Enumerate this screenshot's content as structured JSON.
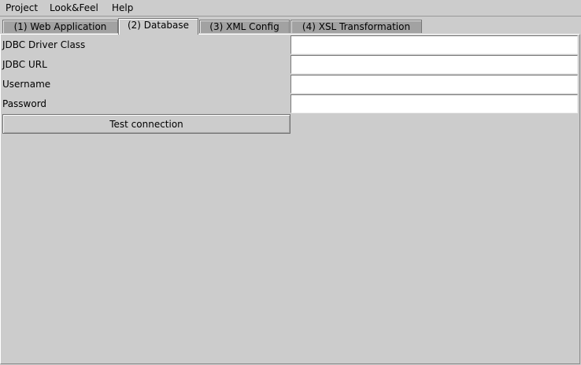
{
  "menubar": {
    "items": [
      "Project",
      "Look&Feel",
      "Help"
    ]
  },
  "tabs": [
    {
      "label": "(1) Web Application",
      "selected": false
    },
    {
      "label": "(2) Database",
      "selected": true
    },
    {
      "label": "(3) XML Config",
      "selected": false
    },
    {
      "label": "(4) XSL Transformation",
      "selected": false
    }
  ],
  "form": {
    "driver_label": "JDBC Driver Class",
    "driver_value": "",
    "url_label": "JDBC URL",
    "url_value": "",
    "username_label": "Username",
    "username_value": "",
    "password_label": "Password",
    "password_value": "",
    "test_button_label": "Test connection"
  },
  "colors": {
    "background": "#cccccc",
    "tab_inactive": "#a2a2a2",
    "field": "#ffffff"
  }
}
